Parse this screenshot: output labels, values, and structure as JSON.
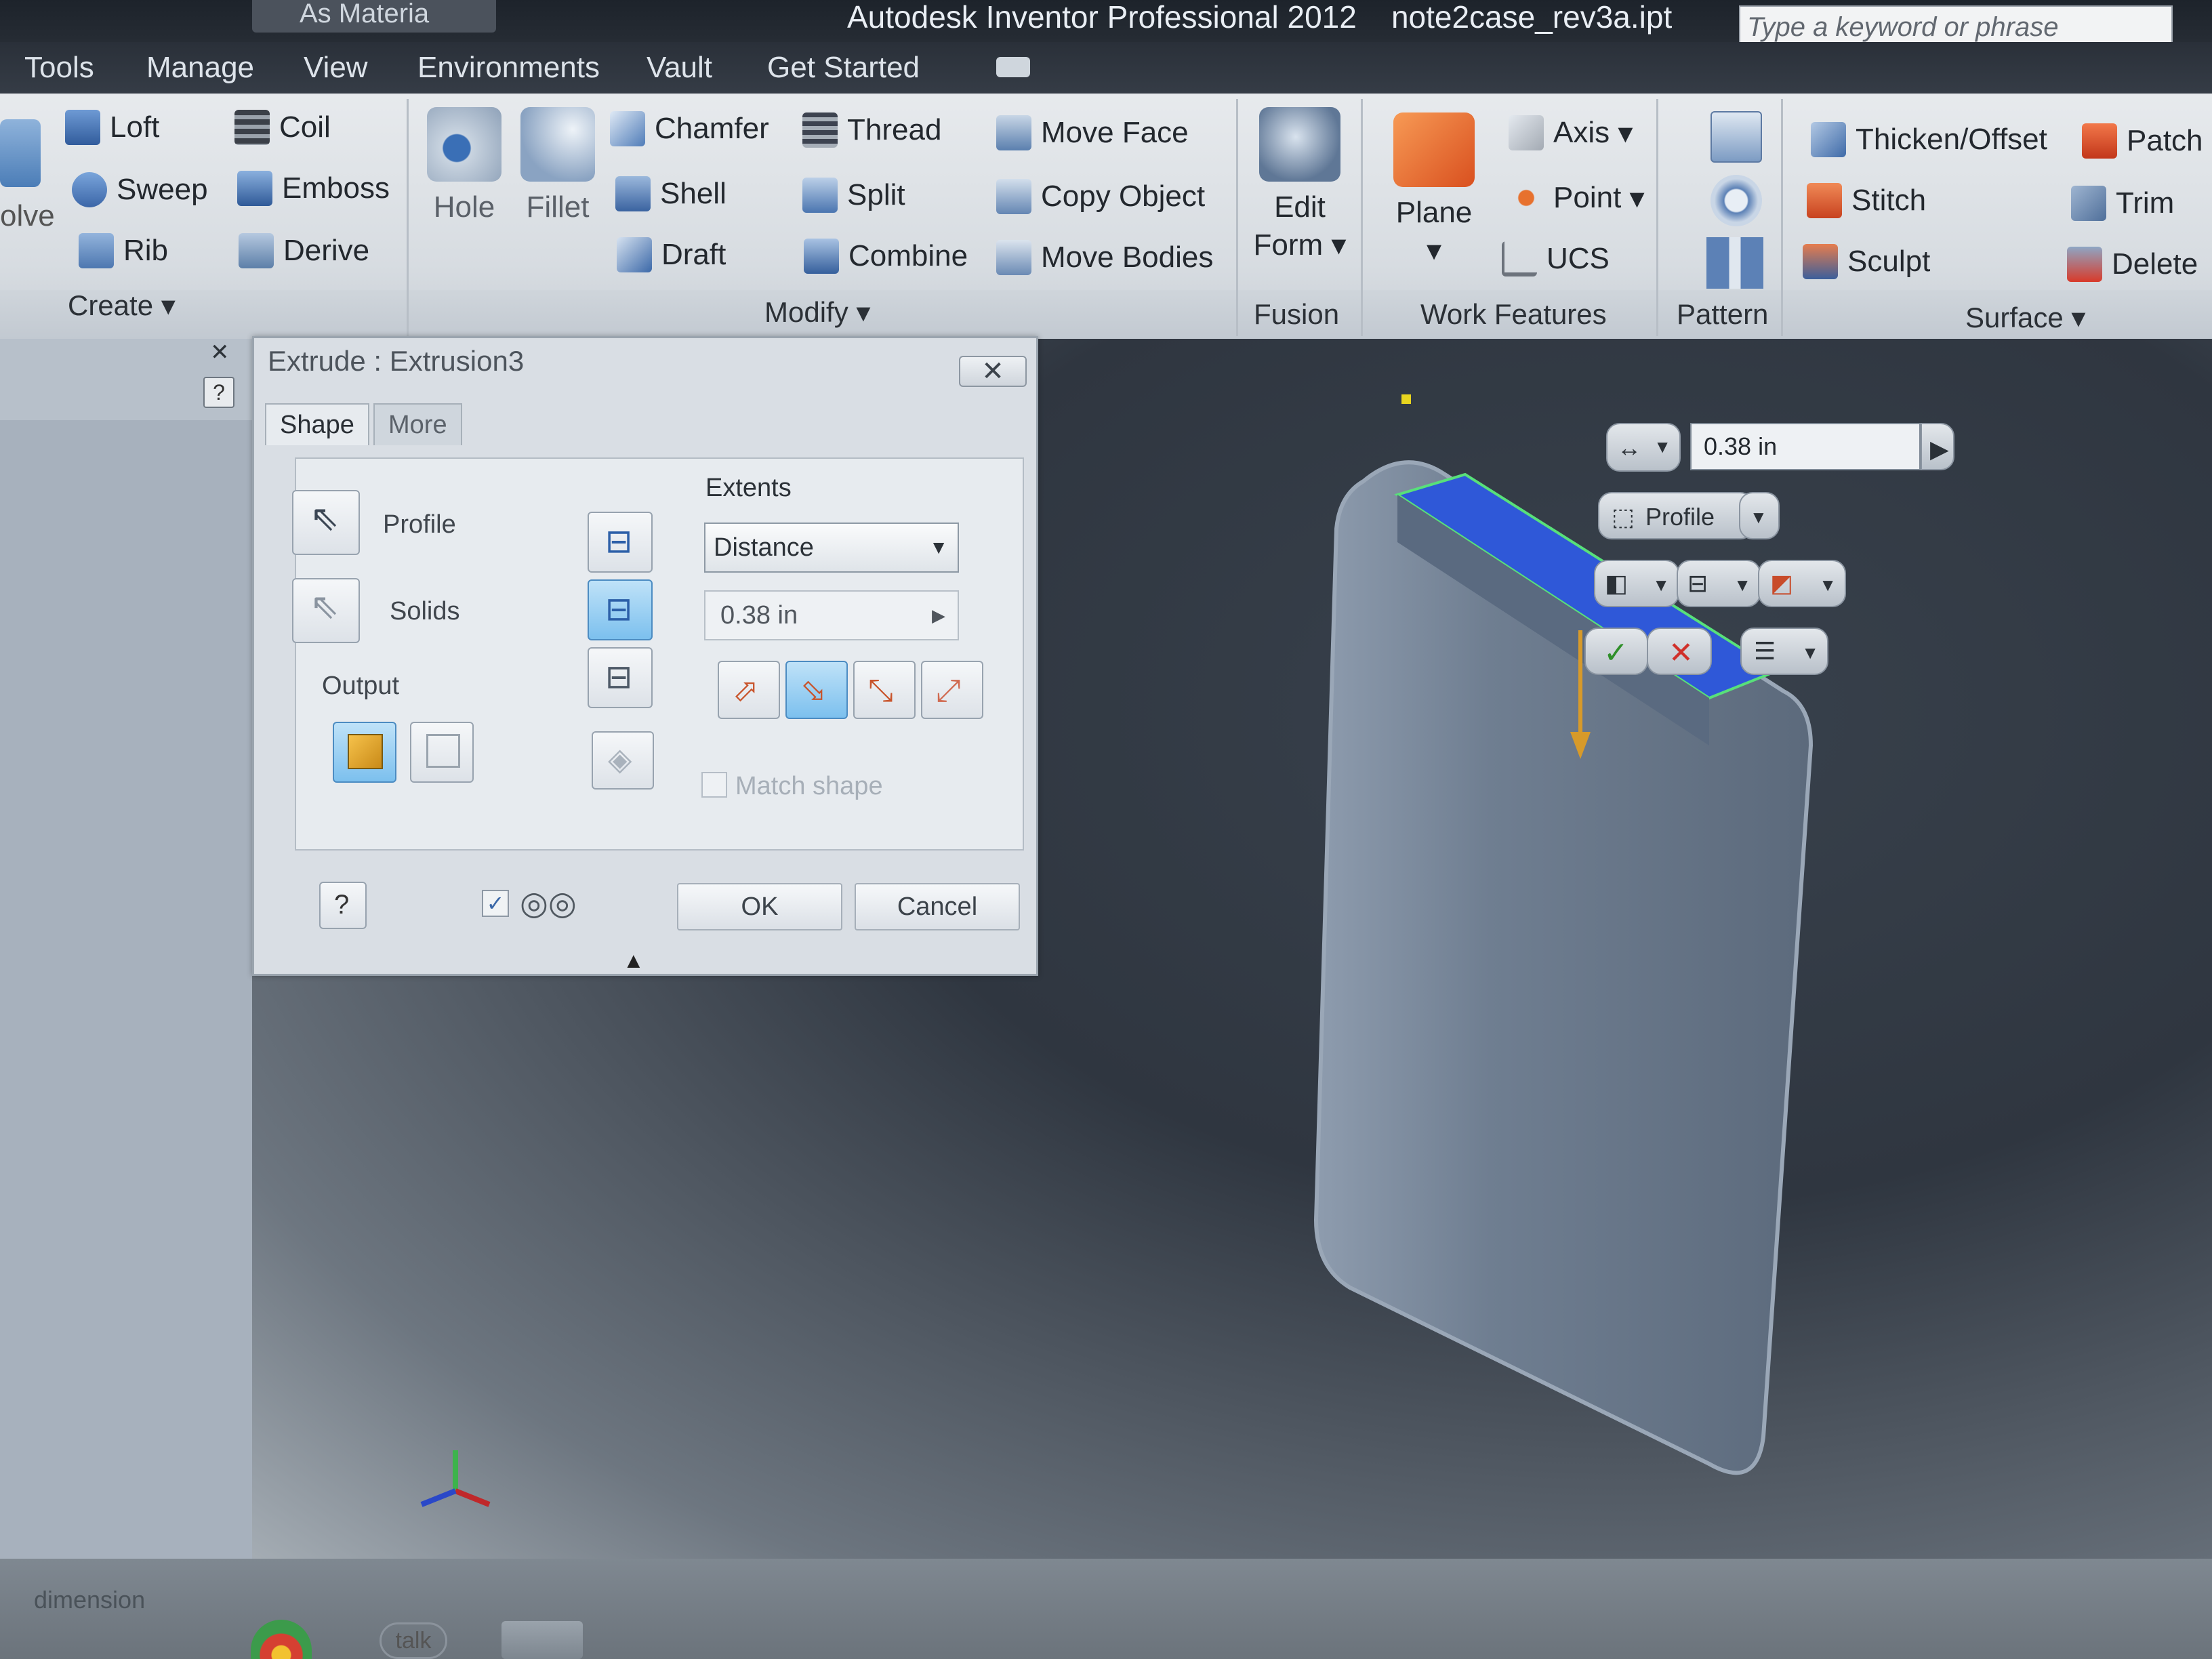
{
  "app": {
    "quick_access_label": "As Materia",
    "title": "Autodesk Inventor Professional 2012",
    "filename": "note2case_rev3a.ipt",
    "search_placeholder": "Type a keyword or phrase"
  },
  "menus": [
    "Tools",
    "Manage",
    "View",
    "Environments",
    "Vault",
    "Get Started"
  ],
  "ribbon": {
    "create": {
      "panel": "Create",
      "revolve_partial": "olve",
      "items": [
        "Loft",
        "Coil",
        "Sweep",
        "Emboss",
        "Rib",
        "Derive"
      ]
    },
    "hole": "Hole",
    "fillet": "Fillet",
    "modify": {
      "panel": "Modify",
      "items": [
        "Chamfer",
        "Thread",
        "Move Face",
        "Shell",
        "Split",
        "Copy Object",
        "Draft",
        "Combine",
        "Move Bodies"
      ]
    },
    "fusion": {
      "panel": "Fusion",
      "edit": "Edit",
      "form": "Form"
    },
    "work_features": {
      "panel": "Work Features",
      "plane": "Plane",
      "axis": "Axis",
      "point": "Point",
      "ucs": "UCS"
    },
    "pattern": {
      "panel": "Pattern"
    },
    "surface": {
      "panel": "Surface",
      "items": [
        "Thicken/Offset",
        "Patch",
        "Stitch",
        "Trim",
        "Sculpt",
        "Delete"
      ]
    }
  },
  "dialog": {
    "title": "Extrude : Extrusion3",
    "tabs": [
      "Shape",
      "More"
    ],
    "profile": "Profile",
    "solids": "Solids",
    "output": "Output",
    "extents": "Extents",
    "extent_type": "Distance",
    "distance": "0.38 in",
    "match_shape": "Match shape",
    "ok": "OK",
    "cancel": "Cancel"
  },
  "minitoolbar": {
    "distance": "0.38 in",
    "profile": "Profile"
  },
  "status": {
    "text": "dimension",
    "taskbar_talk": "talk"
  },
  "colors": {
    "accent_blue": "#2f58d8",
    "ribbon_bg": "#dde1e5",
    "viewport": "#343b45"
  }
}
